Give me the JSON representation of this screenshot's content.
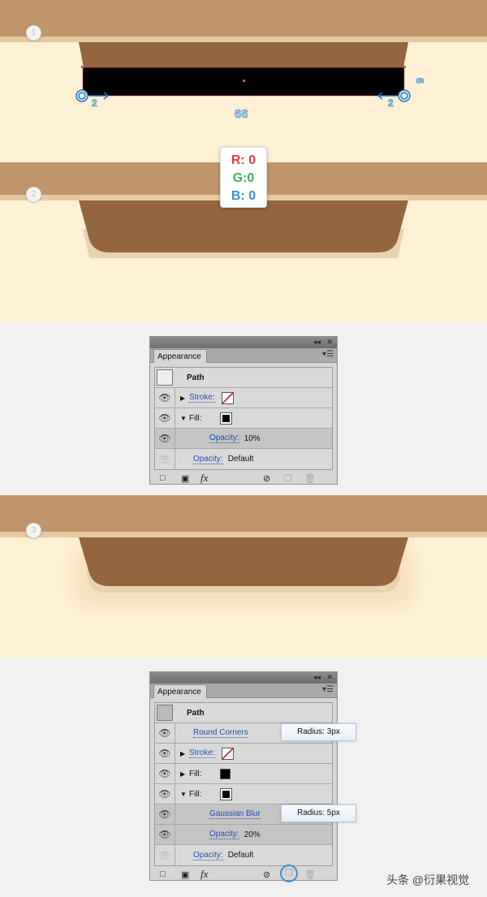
{
  "steps": [
    "1",
    "2",
    "3"
  ],
  "measurements": {
    "left_offset": "2",
    "right_offset": "2",
    "width": "66",
    "height": "6"
  },
  "rgb": {
    "r": "R: 0",
    "g": "G:0",
    "b": "B: 0"
  },
  "colors": {
    "band": "#c0956a",
    "strip": "#e4c9a1",
    "background": "#fdf0d5",
    "shape": "#93663f",
    "rect": "#000000"
  },
  "panel1": {
    "title": "Appearance",
    "path": "Path",
    "rows": [
      {
        "label": "Stroke:",
        "value": ""
      },
      {
        "label": "Fill:",
        "value": ""
      },
      {
        "label": "Opacity:",
        "value": "10%"
      },
      {
        "label": "Opacity:",
        "value": "Default"
      }
    ]
  },
  "panel2": {
    "title": "Appearance",
    "path": "Path",
    "rows": [
      {
        "label": "Round Corners",
        "value": ""
      },
      {
        "label": "Stroke:",
        "value": ""
      },
      {
        "label": "Fill:",
        "value": ""
      },
      {
        "label": "Fill:",
        "value": ""
      },
      {
        "label": "Gaussian Blur",
        "value": ""
      },
      {
        "label": "Opacity:",
        "value": "20%"
      },
      {
        "label": "Opacity:",
        "value": "Default"
      }
    ]
  },
  "tooltips": {
    "round_corners": "Radius: 3px",
    "gaussian_blur": "Radius: 5px"
  },
  "panel_icons": {
    "fx": "fx"
  },
  "watermark": "头条 @衍果视觉"
}
